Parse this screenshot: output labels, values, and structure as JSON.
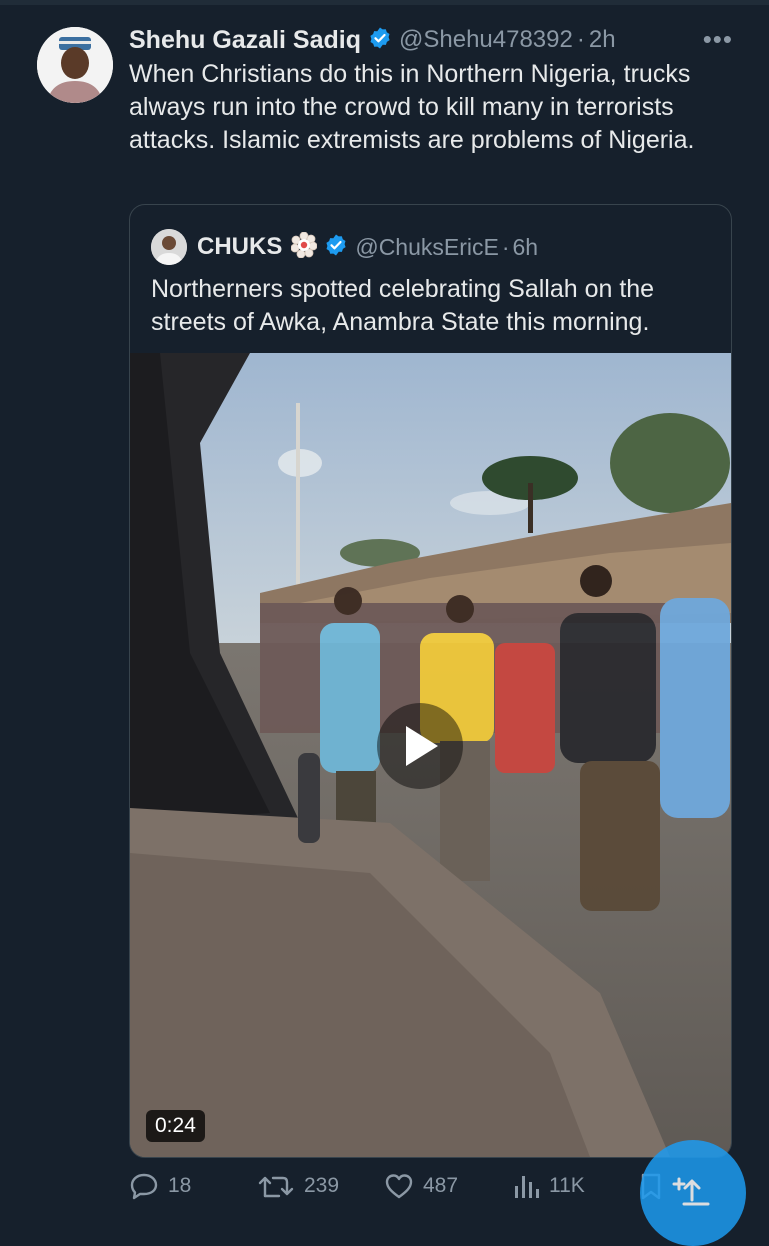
{
  "tweet": {
    "author_name": "Shehu Gazali Sadiq",
    "handle": "@Shehu478392",
    "separator": "·",
    "time": "2h",
    "more_label": "•••",
    "text": "When Christians do this in Northern Nigeria, trucks always run into the crowd to kill many in terrorists attacks. Islamic extremists are problems of Nigeria."
  },
  "quote": {
    "author_name": "CHUKS",
    "handle": "@ChuksEricE",
    "separator": "·",
    "time": "6h",
    "text": "Northerners spotted celebrating Sallah on the streets of Awka, Anambra State this morning.",
    "video_duration": "0:24"
  },
  "actions": {
    "replies": "18",
    "retweets": "239",
    "likes": "487",
    "views": "11K"
  },
  "colors": {
    "background": "#16202c",
    "verified_blue": "#1d9bf0",
    "muted_text": "#8b98a5",
    "border": "#38444d"
  },
  "icons": [
    "verified-badge-icon",
    "more-icon",
    "flower-emoji-icon",
    "play-icon",
    "reply-icon",
    "retweet-icon",
    "like-icon",
    "views-icon",
    "bookmark-icon",
    "compose-icon"
  ]
}
